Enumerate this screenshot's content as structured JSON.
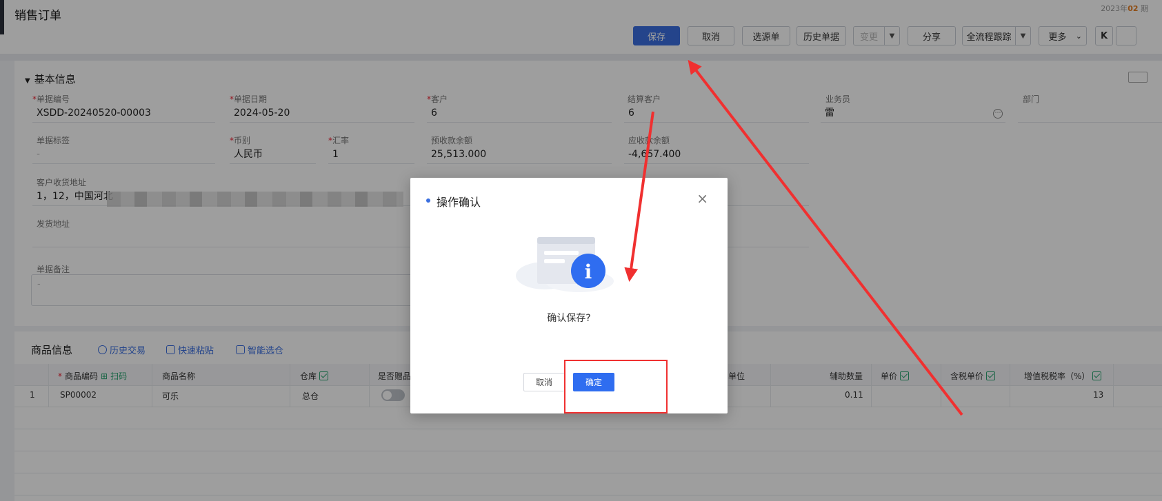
{
  "window": {
    "title": "销售订单",
    "period_prefix": "2023年",
    "period_num": "02",
    "period_suffix": "期"
  },
  "toolbar": {
    "save": "保存",
    "cancel": "取消",
    "select_source": "选源单",
    "history_docs": "历史单据",
    "change": "变更",
    "share": "分享",
    "full_trace": "全流程跟踪",
    "more": "更多",
    "first_nav": "K"
  },
  "basic": {
    "section_title": "基本信息",
    "doc_no": {
      "label": "单据编号",
      "value": "XSDD-20240520-00003"
    },
    "doc_date": {
      "label": "单据日期",
      "value": "2024-05-20"
    },
    "customer": {
      "label": "客户",
      "value": "6"
    },
    "settle_customer": {
      "label": "结算客户",
      "value": "6"
    },
    "salesman": {
      "label": "业务员",
      "value": "雷"
    },
    "department": {
      "label": "部门",
      "value": ""
    },
    "doc_tag": {
      "label": "单据标签",
      "value": "-"
    },
    "currency": {
      "label": "币别",
      "value": "人民币"
    },
    "rate": {
      "label": "汇率",
      "value": "1"
    },
    "prepaid_balance": {
      "label": "预收款余额",
      "value": "25,513.000"
    },
    "receivable_balance": {
      "label": "应收款余额",
      "value": "-4,657.400"
    },
    "customer_address": {
      "label": "客户收货地址",
      "value": "1，12，中国河北"
    },
    "ship_address": {
      "label": "发货地址",
      "value": ""
    },
    "remark": {
      "label": "单据备注",
      "value": "-"
    }
  },
  "goods": {
    "section_title": "商品信息",
    "links": {
      "history_trade": "历史交易",
      "quick_paste": "快速粘贴",
      "smart_select": "智能选仓"
    },
    "columns": {
      "code": "商品编码",
      "scan": "扫码",
      "name": "商品名称",
      "warehouse": "仓库",
      "is_gift": "是否赠品",
      "unit": "单位",
      "aux_qty": "辅助数量",
      "price": "单价",
      "tax_price": "含税单价",
      "vat_rate": "增值税税率（%）"
    },
    "rows": [
      {
        "index": "1",
        "code": "SP00002",
        "name": "可乐",
        "warehouse": "总仓",
        "is_gift": false,
        "aux_qty": "0.11",
        "vat_rate": "13"
      }
    ]
  },
  "dialog": {
    "title": "操作确认",
    "message": "确认保存?",
    "cancel": "取消",
    "confirm": "确定",
    "icon": "info-icon"
  },
  "colors": {
    "primary": "#3a6fe0",
    "annotation": "#f03030",
    "required": "#e23"
  }
}
